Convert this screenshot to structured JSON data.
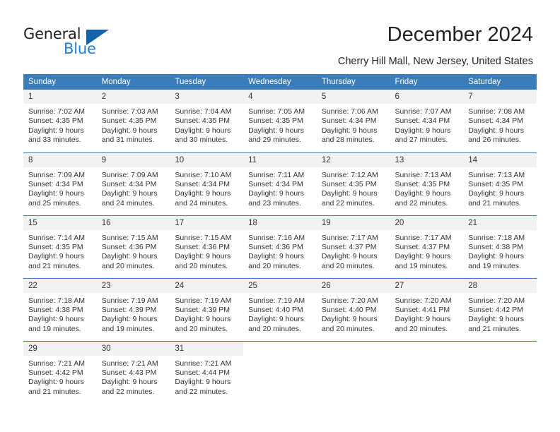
{
  "brand": {
    "name_part1": "General",
    "name_part2": "Blue",
    "triangle_color": "#1464aa",
    "blue_color": "#1c7fd4"
  },
  "header": {
    "title": "December 2024",
    "subtitle": "Cherry Hill Mall, New Jersey, United States",
    "accent_color": "#3b7cba",
    "row_stripe_color": "#f2f2f2"
  },
  "weekdays": [
    "Sunday",
    "Monday",
    "Tuesday",
    "Wednesday",
    "Thursday",
    "Friday",
    "Saturday"
  ],
  "weeks": [
    [
      {
        "day": "1",
        "sunrise": "Sunrise: 7:02 AM",
        "sunset": "Sunset: 4:35 PM",
        "daylight1": "Daylight: 9 hours",
        "daylight2": "and 33 minutes."
      },
      {
        "day": "2",
        "sunrise": "Sunrise: 7:03 AM",
        "sunset": "Sunset: 4:35 PM",
        "daylight1": "Daylight: 9 hours",
        "daylight2": "and 31 minutes."
      },
      {
        "day": "3",
        "sunrise": "Sunrise: 7:04 AM",
        "sunset": "Sunset: 4:35 PM",
        "daylight1": "Daylight: 9 hours",
        "daylight2": "and 30 minutes."
      },
      {
        "day": "4",
        "sunrise": "Sunrise: 7:05 AM",
        "sunset": "Sunset: 4:35 PM",
        "daylight1": "Daylight: 9 hours",
        "daylight2": "and 29 minutes."
      },
      {
        "day": "5",
        "sunrise": "Sunrise: 7:06 AM",
        "sunset": "Sunset: 4:34 PM",
        "daylight1": "Daylight: 9 hours",
        "daylight2": "and 28 minutes."
      },
      {
        "day": "6",
        "sunrise": "Sunrise: 7:07 AM",
        "sunset": "Sunset: 4:34 PM",
        "daylight1": "Daylight: 9 hours",
        "daylight2": "and 27 minutes."
      },
      {
        "day": "7",
        "sunrise": "Sunrise: 7:08 AM",
        "sunset": "Sunset: 4:34 PM",
        "daylight1": "Daylight: 9 hours",
        "daylight2": "and 26 minutes."
      }
    ],
    [
      {
        "day": "8",
        "sunrise": "Sunrise: 7:09 AM",
        "sunset": "Sunset: 4:34 PM",
        "daylight1": "Daylight: 9 hours",
        "daylight2": "and 25 minutes."
      },
      {
        "day": "9",
        "sunrise": "Sunrise: 7:09 AM",
        "sunset": "Sunset: 4:34 PM",
        "daylight1": "Daylight: 9 hours",
        "daylight2": "and 24 minutes."
      },
      {
        "day": "10",
        "sunrise": "Sunrise: 7:10 AM",
        "sunset": "Sunset: 4:34 PM",
        "daylight1": "Daylight: 9 hours",
        "daylight2": "and 24 minutes."
      },
      {
        "day": "11",
        "sunrise": "Sunrise: 7:11 AM",
        "sunset": "Sunset: 4:34 PM",
        "daylight1": "Daylight: 9 hours",
        "daylight2": "and 23 minutes."
      },
      {
        "day": "12",
        "sunrise": "Sunrise: 7:12 AM",
        "sunset": "Sunset: 4:35 PM",
        "daylight1": "Daylight: 9 hours",
        "daylight2": "and 22 minutes."
      },
      {
        "day": "13",
        "sunrise": "Sunrise: 7:13 AM",
        "sunset": "Sunset: 4:35 PM",
        "daylight1": "Daylight: 9 hours",
        "daylight2": "and 22 minutes."
      },
      {
        "day": "14",
        "sunrise": "Sunrise: 7:13 AM",
        "sunset": "Sunset: 4:35 PM",
        "daylight1": "Daylight: 9 hours",
        "daylight2": "and 21 minutes."
      }
    ],
    [
      {
        "day": "15",
        "sunrise": "Sunrise: 7:14 AM",
        "sunset": "Sunset: 4:35 PM",
        "daylight1": "Daylight: 9 hours",
        "daylight2": "and 21 minutes."
      },
      {
        "day": "16",
        "sunrise": "Sunrise: 7:15 AM",
        "sunset": "Sunset: 4:36 PM",
        "daylight1": "Daylight: 9 hours",
        "daylight2": "and 20 minutes."
      },
      {
        "day": "17",
        "sunrise": "Sunrise: 7:15 AM",
        "sunset": "Sunset: 4:36 PM",
        "daylight1": "Daylight: 9 hours",
        "daylight2": "and 20 minutes."
      },
      {
        "day": "18",
        "sunrise": "Sunrise: 7:16 AM",
        "sunset": "Sunset: 4:36 PM",
        "daylight1": "Daylight: 9 hours",
        "daylight2": "and 20 minutes."
      },
      {
        "day": "19",
        "sunrise": "Sunrise: 7:17 AM",
        "sunset": "Sunset: 4:37 PM",
        "daylight1": "Daylight: 9 hours",
        "daylight2": "and 20 minutes."
      },
      {
        "day": "20",
        "sunrise": "Sunrise: 7:17 AM",
        "sunset": "Sunset: 4:37 PM",
        "daylight1": "Daylight: 9 hours",
        "daylight2": "and 19 minutes."
      },
      {
        "day": "21",
        "sunrise": "Sunrise: 7:18 AM",
        "sunset": "Sunset: 4:38 PM",
        "daylight1": "Daylight: 9 hours",
        "daylight2": "and 19 minutes."
      }
    ],
    [
      {
        "day": "22",
        "sunrise": "Sunrise: 7:18 AM",
        "sunset": "Sunset: 4:38 PM",
        "daylight1": "Daylight: 9 hours",
        "daylight2": "and 19 minutes."
      },
      {
        "day": "23",
        "sunrise": "Sunrise: 7:19 AM",
        "sunset": "Sunset: 4:39 PM",
        "daylight1": "Daylight: 9 hours",
        "daylight2": "and 19 minutes."
      },
      {
        "day": "24",
        "sunrise": "Sunrise: 7:19 AM",
        "sunset": "Sunset: 4:39 PM",
        "daylight1": "Daylight: 9 hours",
        "daylight2": "and 20 minutes."
      },
      {
        "day": "25",
        "sunrise": "Sunrise: 7:19 AM",
        "sunset": "Sunset: 4:40 PM",
        "daylight1": "Daylight: 9 hours",
        "daylight2": "and 20 minutes."
      },
      {
        "day": "26",
        "sunrise": "Sunrise: 7:20 AM",
        "sunset": "Sunset: 4:40 PM",
        "daylight1": "Daylight: 9 hours",
        "daylight2": "and 20 minutes."
      },
      {
        "day": "27",
        "sunrise": "Sunrise: 7:20 AM",
        "sunset": "Sunset: 4:41 PM",
        "daylight1": "Daylight: 9 hours",
        "daylight2": "and 20 minutes."
      },
      {
        "day": "28",
        "sunrise": "Sunrise: 7:20 AM",
        "sunset": "Sunset: 4:42 PM",
        "daylight1": "Daylight: 9 hours",
        "daylight2": "and 21 minutes."
      }
    ],
    [
      {
        "day": "29",
        "sunrise": "Sunrise: 7:21 AM",
        "sunset": "Sunset: 4:42 PM",
        "daylight1": "Daylight: 9 hours",
        "daylight2": "and 21 minutes."
      },
      {
        "day": "30",
        "sunrise": "Sunrise: 7:21 AM",
        "sunset": "Sunset: 4:43 PM",
        "daylight1": "Daylight: 9 hours",
        "daylight2": "and 22 minutes."
      },
      {
        "day": "31",
        "sunrise": "Sunrise: 7:21 AM",
        "sunset": "Sunset: 4:44 PM",
        "daylight1": "Daylight: 9 hours",
        "daylight2": "and 22 minutes."
      },
      {
        "day": "",
        "sunrise": "",
        "sunset": "",
        "daylight1": "",
        "daylight2": ""
      },
      {
        "day": "",
        "sunrise": "",
        "sunset": "",
        "daylight1": "",
        "daylight2": ""
      },
      {
        "day": "",
        "sunrise": "",
        "sunset": "",
        "daylight1": "",
        "daylight2": ""
      },
      {
        "day": "",
        "sunrise": "",
        "sunset": "",
        "daylight1": "",
        "daylight2": ""
      }
    ]
  ]
}
